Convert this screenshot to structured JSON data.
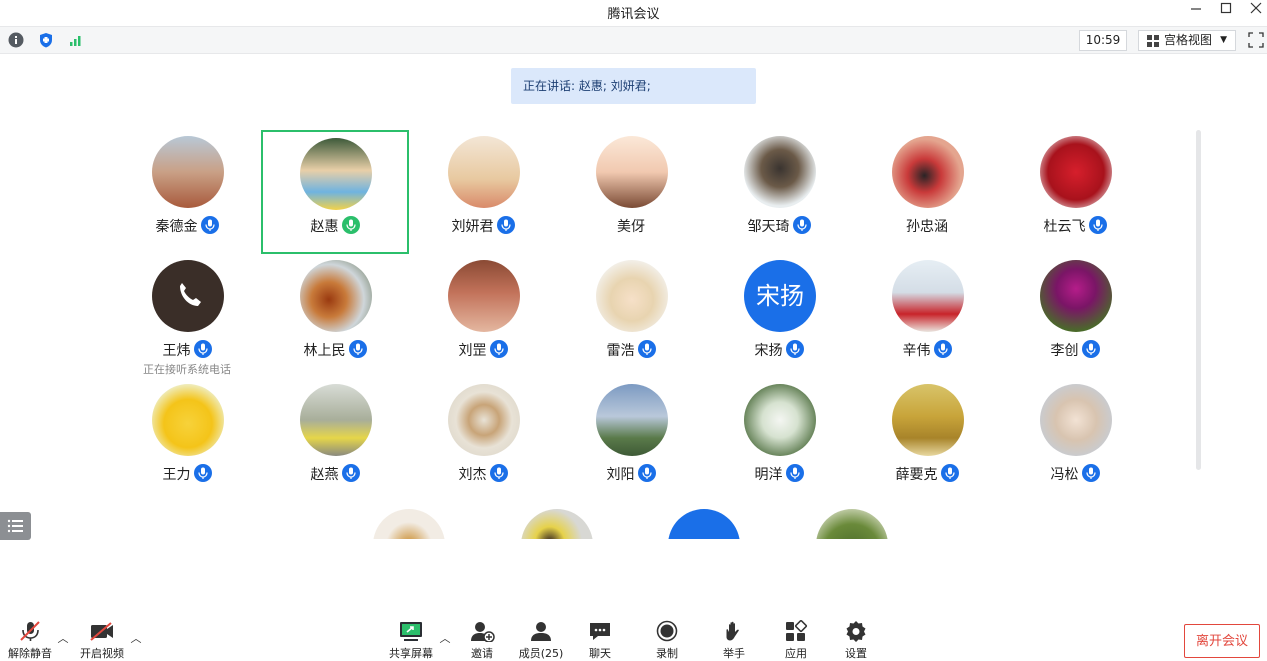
{
  "window": {
    "title": "腾讯会议"
  },
  "toolbar": {
    "time": "10:59",
    "view_label": "宫格视图"
  },
  "speaking": {
    "text": "正在讲话: 赵惠; 刘妍君;"
  },
  "participants": [
    {
      "name": "秦德金"
    },
    {
      "name": "赵惠"
    },
    {
      "name": "刘妍君"
    },
    {
      "name": "美伢"
    },
    {
      "name": "邹天琦"
    },
    {
      "name": "孙忠涵"
    },
    {
      "name": "杜云飞"
    },
    {
      "name": "王炜",
      "sub": "正在接听系统电话"
    },
    {
      "name": "林上民"
    },
    {
      "name": "刘罡"
    },
    {
      "name": "雷浩"
    },
    {
      "name": "宋扬",
      "avatar_text": "宋扬"
    },
    {
      "name": "辛伟"
    },
    {
      "name": "李创"
    },
    {
      "name": "王力"
    },
    {
      "name": "赵燕"
    },
    {
      "name": "刘杰"
    },
    {
      "name": "刘阳"
    },
    {
      "name": "明洋"
    },
    {
      "name": "薛要克"
    },
    {
      "name": "冯松"
    }
  ],
  "bottom": {
    "unmute": "解除静音",
    "video": "开启视频",
    "share": "共享屏幕",
    "invite": "邀请",
    "members": "成员(25)",
    "chat": "聊天",
    "record": "录制",
    "raise_hand": "举手",
    "apps": "应用",
    "settings": "设置",
    "leave": "离开会议"
  }
}
